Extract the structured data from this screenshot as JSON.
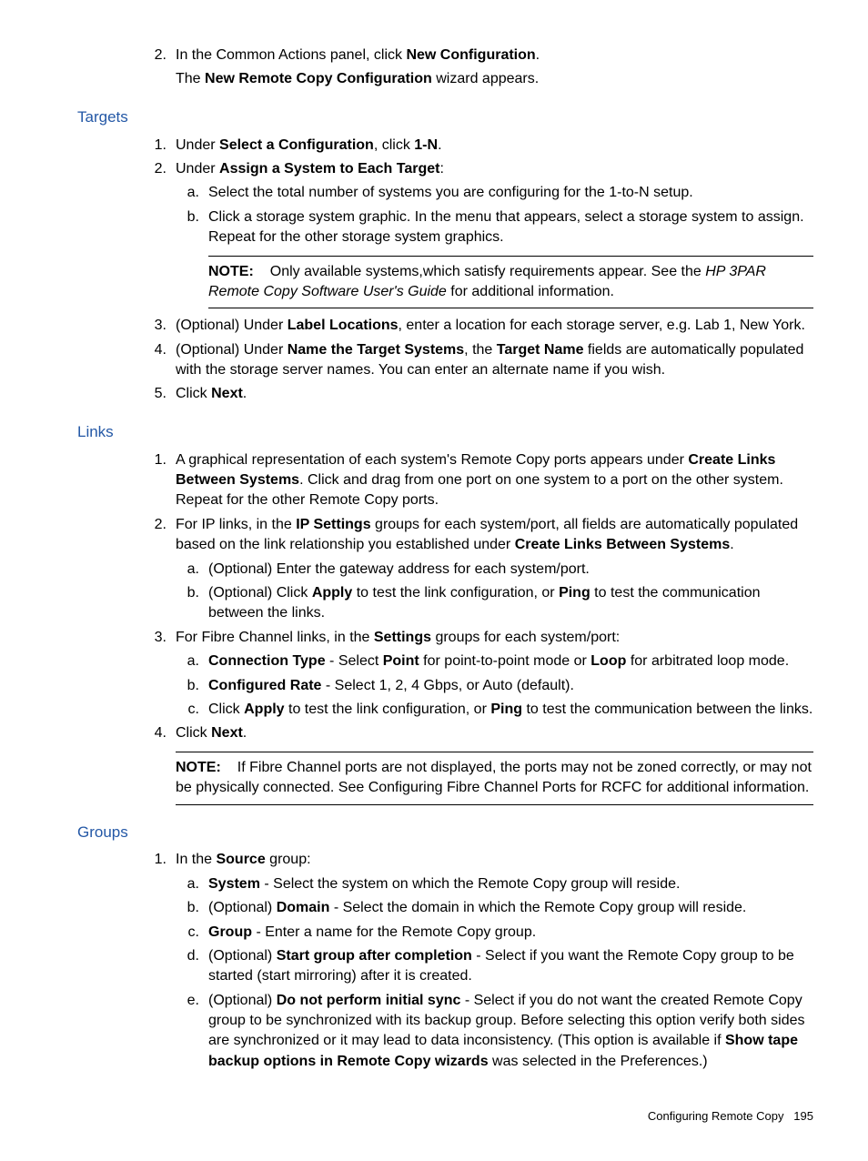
{
  "intro": {
    "step2": {
      "marker": "2.",
      "text_before": "In the Common Actions panel, click ",
      "bold1": "New Configuration",
      "after1": ".",
      "line2_before": "The ",
      "line2_bold": "New Remote Copy Configuration",
      "line2_after": " wizard appears."
    }
  },
  "targets": {
    "heading": "Targets",
    "s1": {
      "marker": "1.",
      "t1": "Under ",
      "b1": "Select a Configuration",
      "t2": ", click ",
      "b2": "1-N",
      "t3": "."
    },
    "s2": {
      "marker": "2.",
      "t1": "Under ",
      "b1": "Assign a System to Each Target",
      "t2": ":"
    },
    "s2a": {
      "marker": "a.",
      "text": "Select the total number of systems you are configuring for the 1-to-N setup."
    },
    "s2b": {
      "marker": "b.",
      "text": "Click a storage system graphic. In the menu that appears, select a storage system to assign. Repeat for the other storage system graphics."
    },
    "note1": {
      "label": "NOTE:",
      "t1": "Only available systems,which satisfy requirements appear. See the ",
      "i1": "HP 3PAR Remote Copy Software User's Guide",
      "t2": " for additional information."
    },
    "s3": {
      "marker": "3.",
      "t1": "(Optional) Under ",
      "b1": "Label Locations",
      "t2": ", enter a location for each storage server, e.g. Lab 1, New York."
    },
    "s4": {
      "marker": "4.",
      "t1": "(Optional) Under ",
      "b1": "Name the Target Systems",
      "t2": ", the ",
      "b2": "Target Name",
      "t3": " fields are automatically populated with the storage server names. You can enter an alternate name if you wish."
    },
    "s5": {
      "marker": "5.",
      "t1": "Click ",
      "b1": "Next",
      "t2": "."
    }
  },
  "links": {
    "heading": "Links",
    "s1": {
      "marker": "1.",
      "t1": "A graphical representation of each system's Remote Copy ports appears under ",
      "b1": "Create Links Between Systems",
      "t2": ". Click and drag from one port on one system to a port on the other system. Repeat for the other Remote Copy ports."
    },
    "s2": {
      "marker": "2.",
      "t1": "For IP links, in the ",
      "b1": "IP Settings",
      "t2": " groups for each system/port, all fields are automatically populated based on the link relationship you established under ",
      "b2": "Create Links Between Systems",
      "t3": "."
    },
    "s2a": {
      "marker": "a.",
      "text": "(Optional) Enter the gateway address for each system/port."
    },
    "s2b": {
      "marker": "b.",
      "t1": "(Optional) Click ",
      "b1": "Apply",
      "t2": " to test the link configuration, or ",
      "b2": "Ping",
      "t3": " to test the communication between the links."
    },
    "s3": {
      "marker": "3.",
      "t1": "For Fibre Channel links, in the ",
      "b1": "Settings",
      "t2": " groups for each system/port:"
    },
    "s3a": {
      "marker": "a.",
      "b1": "Connection Type",
      "t1": " - Select ",
      "b2": "Point",
      "t2": " for point-to-point mode or ",
      "b3": "Loop",
      "t3": " for arbitrated loop mode."
    },
    "s3b": {
      "marker": "b.",
      "b1": "Configured Rate",
      "t1": " - Select 1, 2, 4 Gbps, or Auto (default)."
    },
    "s3c": {
      "marker": "c.",
      "t1": "Click ",
      "b1": "Apply",
      "t2": " to test the link configuration, or ",
      "b2": "Ping",
      "t3": " to test the communication between the links."
    },
    "s4": {
      "marker": "4.",
      "t1": "Click ",
      "b1": "Next",
      "t2": "."
    },
    "note1": {
      "label": "NOTE:",
      "text": "If Fibre Channel ports are not displayed, the ports may not be zoned correctly, or may not be physically connected. See Configuring Fibre Channel Ports for RCFC for additional information."
    }
  },
  "groups": {
    "heading": "Groups",
    "s1": {
      "marker": "1.",
      "t1": "In the ",
      "b1": "Source",
      "t2": " group:"
    },
    "s1a": {
      "marker": "a.",
      "b1": "System",
      "t1": " - Select the system on which the Remote Copy group will reside."
    },
    "s1b": {
      "marker": "b.",
      "t1": "(Optional) ",
      "b1": "Domain",
      "t2": " - Select the domain in which the Remote Copy group will reside."
    },
    "s1c": {
      "marker": "c.",
      "b1": "Group",
      "t1": " - Enter a name for the Remote Copy group."
    },
    "s1d": {
      "marker": "d.",
      "t1": "(Optional) ",
      "b1": "Start group after completion",
      "t2": " - Select if you want the Remote Copy group to be started (start mirroring) after it is created."
    },
    "s1e": {
      "marker": "e.",
      "t1": "(Optional) ",
      "b1": "Do not perform initial sync",
      "t2": " - Select if you do not want the created Remote Copy group to be synchronized with its backup group. Before selecting this option verify both sides are synchronized or it may lead to data inconsistency. (This option is available if ",
      "b2": "Show tape backup options in Remote Copy wizards",
      "t3": " was selected in the Preferences.)"
    }
  },
  "footer": {
    "text": "Configuring Remote Copy",
    "page": "195"
  }
}
